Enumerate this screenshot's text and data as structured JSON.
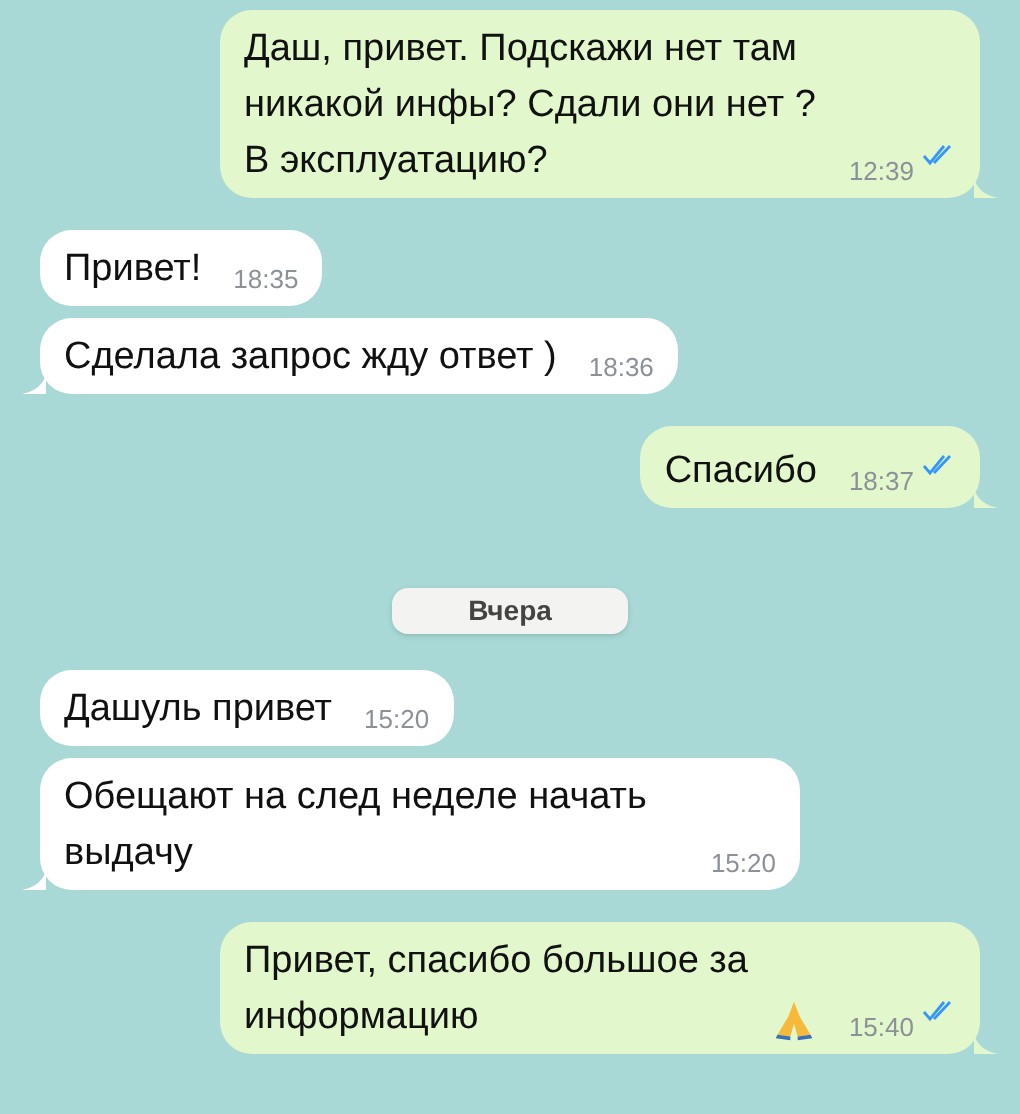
{
  "messages": [
    {
      "kind": "message",
      "outgoing": true,
      "text": "Даш, привет. Подскажи нет там никакой инфы? Сдали они нет ? В эксплуатацию?",
      "time": "12:39",
      "read": true,
      "tail": true,
      "emoji": false
    },
    {
      "kind": "message",
      "outgoing": false,
      "text": "Привет!",
      "time": "18:35",
      "tail": false,
      "emoji": false
    },
    {
      "kind": "message",
      "outgoing": false,
      "text": "Сделала запрос жду ответ )",
      "time": "18:36",
      "tail": true,
      "emoji": false
    },
    {
      "kind": "message",
      "outgoing": true,
      "text": "Спасибо",
      "time": "18:37",
      "read": true,
      "tail": true,
      "emoji": false
    },
    {
      "kind": "date",
      "text": "Вчера"
    },
    {
      "kind": "message",
      "outgoing": false,
      "text": "Дашуль привет",
      "time": "15:20",
      "tail": false,
      "emoji": false
    },
    {
      "kind": "message",
      "outgoing": false,
      "text": "Обещают на след неделе начать выдачу",
      "time": "15:20",
      "tail": true,
      "emoji": false
    },
    {
      "kind": "message",
      "outgoing": true,
      "text": "Привет, спасибо большое за информацию",
      "time": "15:40",
      "read": true,
      "tail": true,
      "emoji": true
    }
  ]
}
